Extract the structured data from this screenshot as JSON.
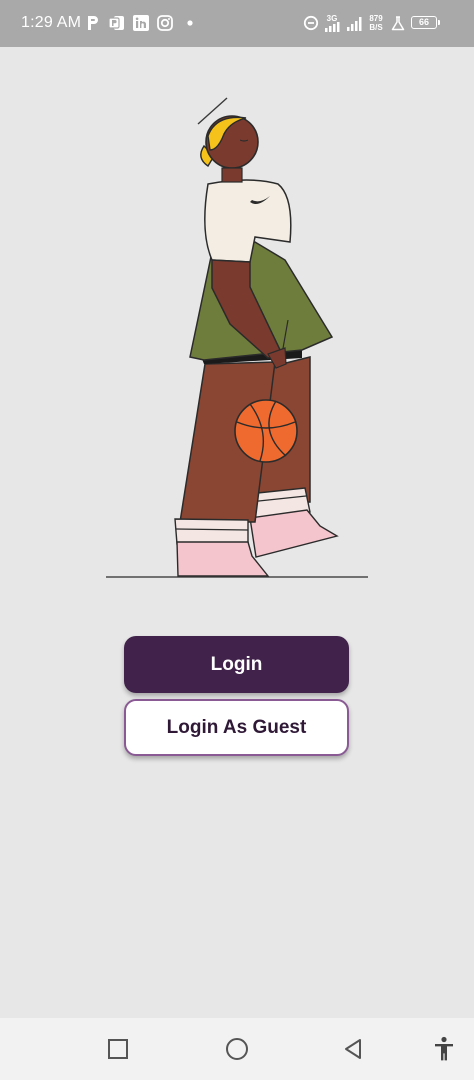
{
  "status_bar": {
    "time": "1:29 AM",
    "left_icons": [
      "parking-app-icon",
      "powerpoint-icon",
      "linkedin-icon",
      "instagram-icon",
      "notification-dot-icon"
    ],
    "right_icons": [
      "data-saver-icon",
      "mobile-signal-icon",
      "wifi-signal-icon",
      "lab-icon",
      "battery-icon"
    ],
    "network_type": "3G",
    "net_speed_value": "879",
    "net_speed_unit": "B/S",
    "battery_level": "66"
  },
  "illustration": {
    "name": "basketball-player-illustration",
    "colors": {
      "skin": "#7a3b2e",
      "hair": "#f4c21b",
      "shirt": "#f3ede3",
      "jacket": "#6f7d3c",
      "pants": "#8a4633",
      "ball": "#ef6a2f",
      "socks": "#f4c5cc",
      "outline": "#2b2b2b"
    }
  },
  "buttons": {
    "login_label": "Login",
    "guest_label": "Login As Guest"
  },
  "colors": {
    "primary": "#41224a",
    "guest_border": "#8a5a94",
    "background": "#e7e7e8",
    "status_bar": "#a9a9a9",
    "nav_bar": "#f2f2f2"
  },
  "nav_bar": {
    "icons": [
      "recents-square-icon",
      "home-circle-icon",
      "back-triangle-icon",
      "accessibility-icon"
    ]
  }
}
